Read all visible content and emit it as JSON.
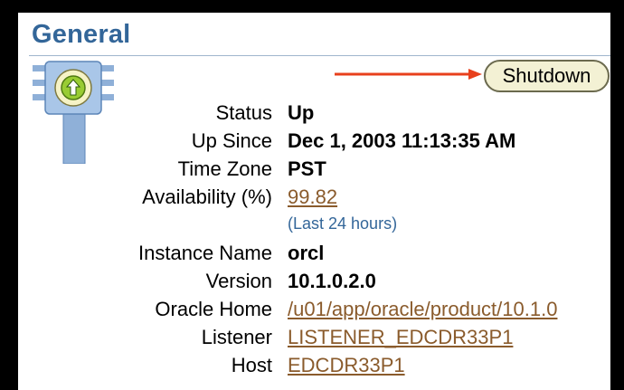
{
  "section": {
    "title": "General"
  },
  "actions": {
    "shutdown_label": "Shutdown"
  },
  "status_icon": {
    "name": "status-up-icon",
    "color": "#99cc33"
  },
  "annotation": {
    "arrow_color": "#e8401c"
  },
  "details": {
    "status": {
      "label": "Status",
      "value": "Up"
    },
    "up_since": {
      "label": "Up Since",
      "value": "Dec 1, 2003 11:13:35 AM"
    },
    "time_zone": {
      "label": "Time Zone",
      "value": "PST"
    },
    "availability": {
      "label": "Availability (%)",
      "value": "99.82",
      "note": "(Last 24 hours)"
    },
    "instance_name": {
      "label": "Instance Name",
      "value": "orcl"
    },
    "version": {
      "label": "Version",
      "value": "10.1.0.2.0"
    },
    "oracle_home": {
      "label": "Oracle Home",
      "value": "/u01/app/oracle/product/10.1.0"
    },
    "listener": {
      "label": "Listener",
      "value": "LISTENER_EDCDR33P1"
    },
    "host": {
      "label": "Host",
      "value": "EDCDR33P1"
    }
  }
}
